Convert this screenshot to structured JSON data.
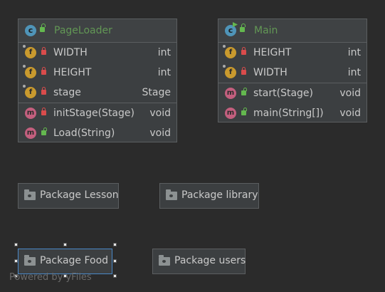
{
  "classes": [
    {
      "name": "PageLoader",
      "members": [
        {
          "kind": "f",
          "name": "WIDTH",
          "type": "int"
        },
        {
          "kind": "f",
          "name": "HEIGHT",
          "type": "int"
        },
        {
          "kind": "f",
          "name": "stage",
          "type": "Stage"
        },
        {
          "kind": "m",
          "name": "initStage(Stage)",
          "type": "void"
        },
        {
          "kind": "m",
          "name": "Load(String)",
          "type": "void"
        }
      ]
    },
    {
      "name": "Main",
      "members": [
        {
          "kind": "f",
          "name": "HEIGHT",
          "type": "int"
        },
        {
          "kind": "f",
          "name": "WIDTH",
          "type": "int"
        },
        {
          "kind": "m",
          "name": "start(Stage)",
          "type": "void"
        },
        {
          "kind": "m",
          "name": "main(String[])",
          "type": "void"
        }
      ]
    }
  ],
  "packages": [
    {
      "label": "Package Lesson"
    },
    {
      "label": "Package library"
    },
    {
      "label": "Package Food"
    },
    {
      "label": "Package users"
    }
  ],
  "watermark": "Powered by yFiles",
  "colors": {
    "background": "#2b2b2b",
    "node": "#3c3f41",
    "class_name": "#629755",
    "selection": "#4a88c7"
  }
}
